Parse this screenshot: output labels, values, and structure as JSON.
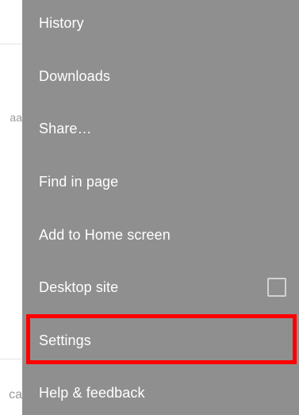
{
  "menu": {
    "items": [
      {
        "label": "History"
      },
      {
        "label": "Downloads"
      },
      {
        "label": "Share…"
      },
      {
        "label": "Find in page"
      },
      {
        "label": "Add to Home screen"
      },
      {
        "label": "Desktop site",
        "checkbox_checked": false
      },
      {
        "label": "Settings",
        "highlighted": true
      },
      {
        "label": "Help & feedback"
      }
    ]
  },
  "background": {
    "fragments": [
      "aa",
      "ca"
    ]
  },
  "colors": {
    "menu_background": "#8f8f8f",
    "menu_text": "#ffffff",
    "highlight_border": "#ff0000",
    "checkbox_border": "#d2d2d2"
  }
}
